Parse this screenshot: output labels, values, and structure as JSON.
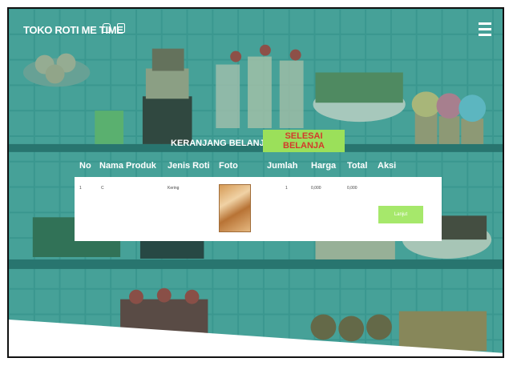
{
  "header": {
    "brand": "TOKO ROTI ME TIME"
  },
  "cart": {
    "heading": "KERANJANG BELANJA ANDA",
    "done_label": "SELESAI BELANJA",
    "columns": [
      "No",
      "Nama Produk",
      "Jenis Roti",
      "Foto",
      "Jumlah",
      "Harga",
      "Total",
      "Aksi"
    ],
    "rows": [
      {
        "no": "1",
        "nama_produk": "C",
        "jenis_roti": "Kering",
        "jumlah": "1",
        "harga": "0,000",
        "total": "0,000"
      }
    ],
    "next_label": "Lanjut"
  },
  "colors": {
    "accent_green": "#9be05a",
    "accent_red": "#d33a2c",
    "teal_overlay": "#1f7a74"
  }
}
